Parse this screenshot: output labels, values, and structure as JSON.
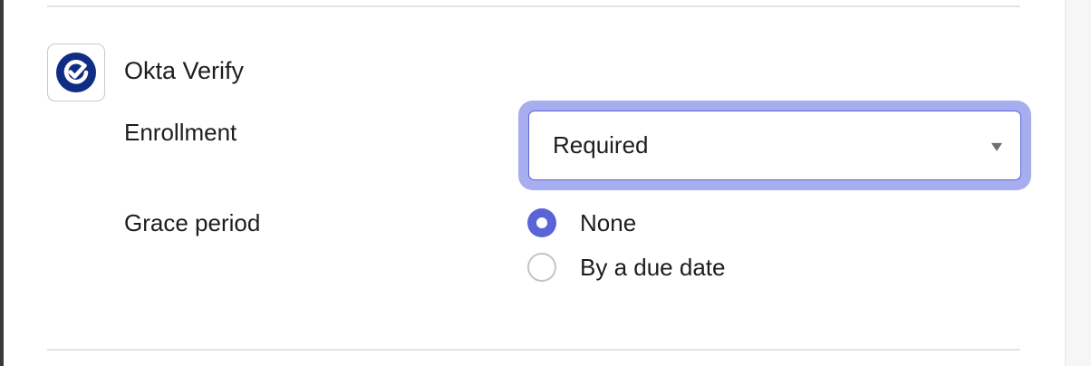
{
  "app": {
    "name": "Okta Verify",
    "icon": "okta-verify-icon",
    "brand_color": "#102d84"
  },
  "enrollment": {
    "label": "Enrollment",
    "selected": "Required",
    "focus_ring_color": "#a7aef0"
  },
  "grace_period": {
    "label": "Grace period",
    "options": [
      {
        "label": "None",
        "checked": true
      },
      {
        "label": "By a due date",
        "checked": false
      }
    ],
    "accent_color": "#5a64d6"
  }
}
